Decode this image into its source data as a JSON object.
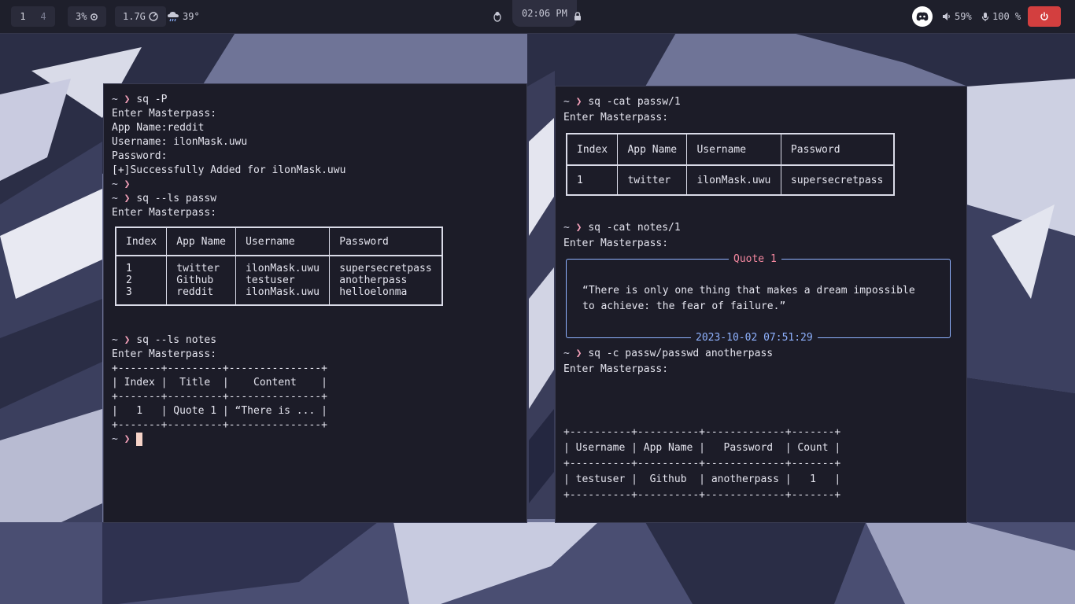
{
  "topbar": {
    "workspaces": [
      "1",
      "4"
    ],
    "cpu": "3%",
    "memory": "1.7G",
    "weather_temp": "39°",
    "clock": "02:06 PM",
    "volume": "59%",
    "mic": "100 %",
    "icons": {
      "cpu": "gear-icon",
      "memory": "gauge-icon",
      "weather": "rain-cloud-icon",
      "distro": "linux-tux-icon",
      "lock": "lock-icon",
      "discord": "discord-icon",
      "volume": "speaker-icon",
      "mic": "microphone-icon",
      "power": "power-icon"
    },
    "colors": {
      "power": "#d33f3f",
      "bar": "#1e1f2b"
    }
  },
  "left_terminal": {
    "lines": [
      "sq -P",
      "Enter Masterpass:",
      "App Name:reddit",
      "Username: ilonMask.uwu",
      "Password:",
      "[+]Successfully Added for ilonMask.uwu",
      "",
      "sq --ls passw",
      "Enter Masterpass:"
    ],
    "prompt": "~",
    "chevron": "❯",
    "pass_table": {
      "headers": [
        "Index",
        "App Name",
        "Username",
        "Password"
      ],
      "rows": [
        [
          "1",
          "twitter",
          "ilonMask.uwu",
          "supersecretpass"
        ],
        [
          "2",
          "Github",
          "testuser",
          "anotherpass"
        ],
        [
          "3",
          "reddit",
          "ilonMask.uwu",
          "helloelonma"
        ]
      ]
    },
    "notes_cmd": "sq --ls notes",
    "notes_master": "Enter Masterpass:",
    "notes_ascii": [
      "+-------+---------+---------------+",
      "| Index |  Title  |    Content    |",
      "+-------+---------+---------------+",
      "|   1   | Quote 1 | “There is ... |",
      "+-------+---------+---------------+"
    ]
  },
  "right_terminal": {
    "cmd1": "sq -cat passw/1",
    "master1": "Enter Masterpass:",
    "cat_table": {
      "headers": [
        "Index",
        "App Name",
        "Username",
        "Password"
      ],
      "rows": [
        [
          "1",
          "twitter",
          "ilonMask.uwu",
          "supersecretpass"
        ]
      ]
    },
    "cmd2": "sq -cat notes/1",
    "master2": "Enter Masterpass:",
    "note": {
      "title": "Quote 1",
      "line1": "“There is only one thing that makes a dream impossible",
      "line2": "to achieve: the fear of failure.”",
      "date": "2023-10-02 07:51:29"
    },
    "cmd3": "sq -c passw/passwd anotherpass",
    "master3": "Enter Masterpass:",
    "count_ascii": [
      "+----------+----------+-------------+-------+",
      "| Username | App Name |   Password  | Count |",
      "+----------+----------+-------------+-------+",
      "| testuser |  Github  | anotherpass |   1   |",
      "+----------+----------+-------------+-------+"
    ]
  }
}
